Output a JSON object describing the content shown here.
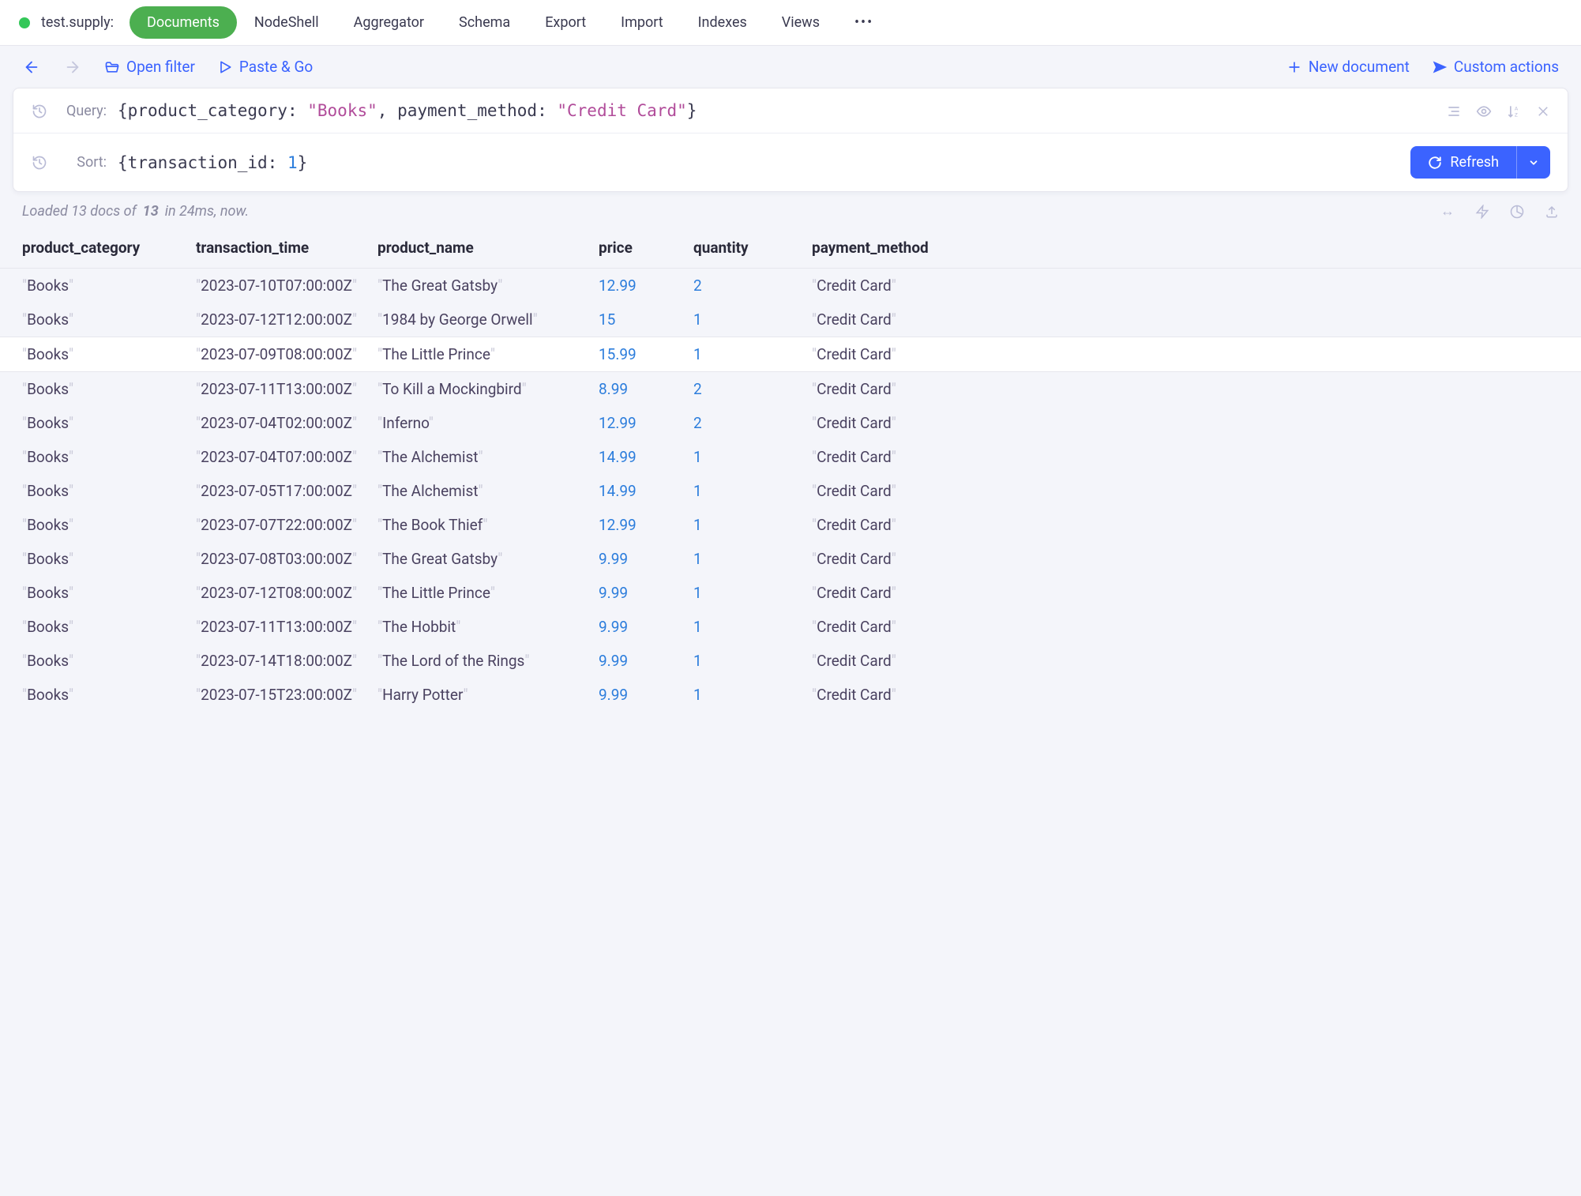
{
  "header": {
    "db_label": "test.supply:",
    "tabs": [
      "Documents",
      "NodeShell",
      "Aggregator",
      "Schema",
      "Export",
      "Import",
      "Indexes",
      "Views"
    ],
    "active_tab": "Documents"
  },
  "toolbar": {
    "open_filter": "Open filter",
    "paste_go": "Paste & Go",
    "new_document": "New document",
    "custom_actions": "Custom actions"
  },
  "query": {
    "label": "Query:",
    "field1": "product_category",
    "value1": "\"Books\"",
    "field2": "payment_method",
    "value2": "\"Credit Card\""
  },
  "sort": {
    "label": "Sort:",
    "field": "transaction_id",
    "value": "1",
    "refresh_label": "Refresh"
  },
  "status": {
    "prefix": "Loaded 13 docs of ",
    "bold": "13",
    "suffix": " in 24ms, now."
  },
  "columns": [
    "product_category",
    "transaction_time",
    "product_name",
    "price",
    "quantity",
    "payment_method"
  ],
  "rows": [
    {
      "product_category": "Books",
      "transaction_time": "2023-07-10T07:00:00Z",
      "product_name": "The Great Gatsby",
      "price": "12.99",
      "quantity": "2",
      "payment_method": "Credit Card"
    },
    {
      "product_category": "Books",
      "transaction_time": "2023-07-12T12:00:00Z",
      "product_name": "1984 by George Orwell",
      "price": "15",
      "quantity": "1",
      "payment_method": "Credit Card"
    },
    {
      "product_category": "Books",
      "transaction_time": "2023-07-09T08:00:00Z",
      "product_name": "The Little Prince",
      "price": "15.99",
      "quantity": "1",
      "payment_method": "Credit Card",
      "_hover": true
    },
    {
      "product_category": "Books",
      "transaction_time": "2023-07-11T13:00:00Z",
      "product_name": "To Kill a Mockingbird",
      "price": "8.99",
      "quantity": "2",
      "payment_method": "Credit Card"
    },
    {
      "product_category": "Books",
      "transaction_time": "2023-07-04T02:00:00Z",
      "product_name": "Inferno",
      "price": "12.99",
      "quantity": "2",
      "payment_method": "Credit Card"
    },
    {
      "product_category": "Books",
      "transaction_time": "2023-07-04T07:00:00Z",
      "product_name": "The Alchemist",
      "price": "14.99",
      "quantity": "1",
      "payment_method": "Credit Card"
    },
    {
      "product_category": "Books",
      "transaction_time": "2023-07-05T17:00:00Z",
      "product_name": "The Alchemist",
      "price": "14.99",
      "quantity": "1",
      "payment_method": "Credit Card"
    },
    {
      "product_category": "Books",
      "transaction_time": "2023-07-07T22:00:00Z",
      "product_name": "The Book Thief",
      "price": "12.99",
      "quantity": "1",
      "payment_method": "Credit Card"
    },
    {
      "product_category": "Books",
      "transaction_time": "2023-07-08T03:00:00Z",
      "product_name": "The Great Gatsby",
      "price": "9.99",
      "quantity": "1",
      "payment_method": "Credit Card"
    },
    {
      "product_category": "Books",
      "transaction_time": "2023-07-12T08:00:00Z",
      "product_name": "The Little Prince",
      "price": "9.99",
      "quantity": "1",
      "payment_method": "Credit Card"
    },
    {
      "product_category": "Books",
      "transaction_time": "2023-07-11T13:00:00Z",
      "product_name": "The Hobbit",
      "price": "9.99",
      "quantity": "1",
      "payment_method": "Credit Card"
    },
    {
      "product_category": "Books",
      "transaction_time": "2023-07-14T18:00:00Z",
      "product_name": "The Lord of the Rings",
      "price": "9.99",
      "quantity": "1",
      "payment_method": "Credit Card"
    },
    {
      "product_category": "Books",
      "transaction_time": "2023-07-15T23:00:00Z",
      "product_name": "Harry Potter",
      "price": "9.99",
      "quantity": "1",
      "payment_method": "Credit Card"
    }
  ]
}
